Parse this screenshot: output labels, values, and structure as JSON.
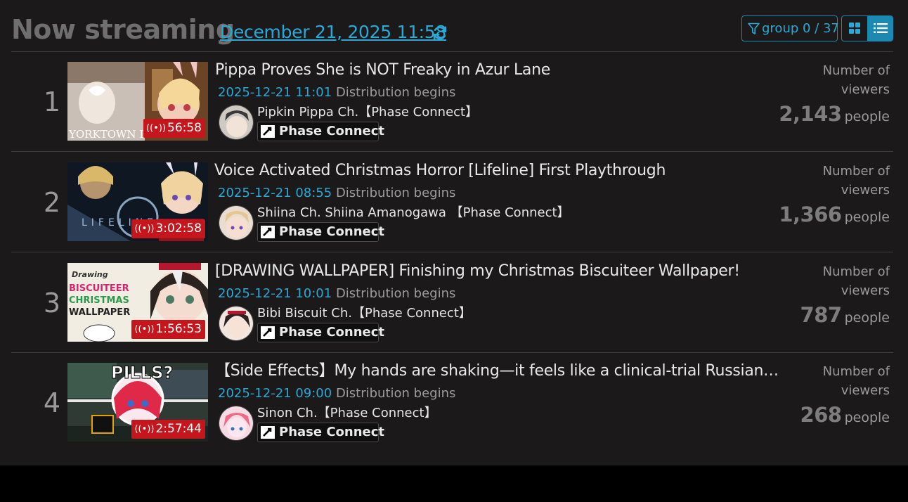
{
  "header": {
    "title": "Now streaming",
    "datetime": "December 21, 2025 11:58",
    "group_filter": "group 0 / 37",
    "icons": {
      "refresh": "refresh-icon",
      "filter": "filter-icon",
      "grid": "grid-view-icon",
      "list": "list-view-icon"
    }
  },
  "colors": {
    "accent": "#2aa8d6",
    "live_badge": "#c4161c",
    "background": "#1b1919"
  },
  "streams": [
    {
      "rank": "1",
      "title": "Pippa Proves She is NOT Freaky in Azur Lane",
      "start_time": "2025-12-21 11:01",
      "start_label": "Distribution begins",
      "channel": "Pipkin Pippa Ch.【Phase Connect】",
      "tag": "Phase Connect",
      "duration": "56:58",
      "viewers_label": "Number of viewers",
      "viewers": "2,143",
      "viewers_unit": "people",
      "thumb_text": "YORKTOWN II"
    },
    {
      "rank": "2",
      "title": "Voice Activated Christmas Horror [Lifeline] First Playthrough",
      "start_time": "2025-12-21 08:55",
      "start_label": "Distribution begins",
      "channel": "Shiina Ch. Shiina Amanogawa 【Phase Connect】",
      "tag": "Phase Connect",
      "duration": "3:02:58",
      "viewers_label": "Number of viewers",
      "viewers": "1,366",
      "viewers_unit": "people",
      "thumb_text": "LIFELINE"
    },
    {
      "rank": "3",
      "title": "[DRAWING WALLPAPER] Finishing my Christmas Biscuiteer Wallpaper!",
      "start_time": "2025-12-21 10:01",
      "start_label": "Distribution begins",
      "channel": "Bibi Biscuit Ch.【Phase Connect】",
      "tag": "Phase Connect",
      "duration": "1:56:53",
      "viewers_label": "Number of viewers",
      "viewers": "787",
      "viewers_unit": "people",
      "thumb_text": "Drawing BISCUITEER CHRISTMAS WALLPAPER"
    },
    {
      "rank": "4",
      "title": "【Side Effects】My hands are shaking—it feels like a clinical-trial Russian r…",
      "start_time": "2025-12-21 09:00",
      "start_label": "Distribution begins",
      "channel": "Sinon Ch.【Phase Connect】",
      "tag": "Phase Connect",
      "duration": "2:57:44",
      "viewers_label": "Number of viewers",
      "viewers": "268",
      "viewers_unit": "people",
      "thumb_text": "PILLS?"
    }
  ]
}
